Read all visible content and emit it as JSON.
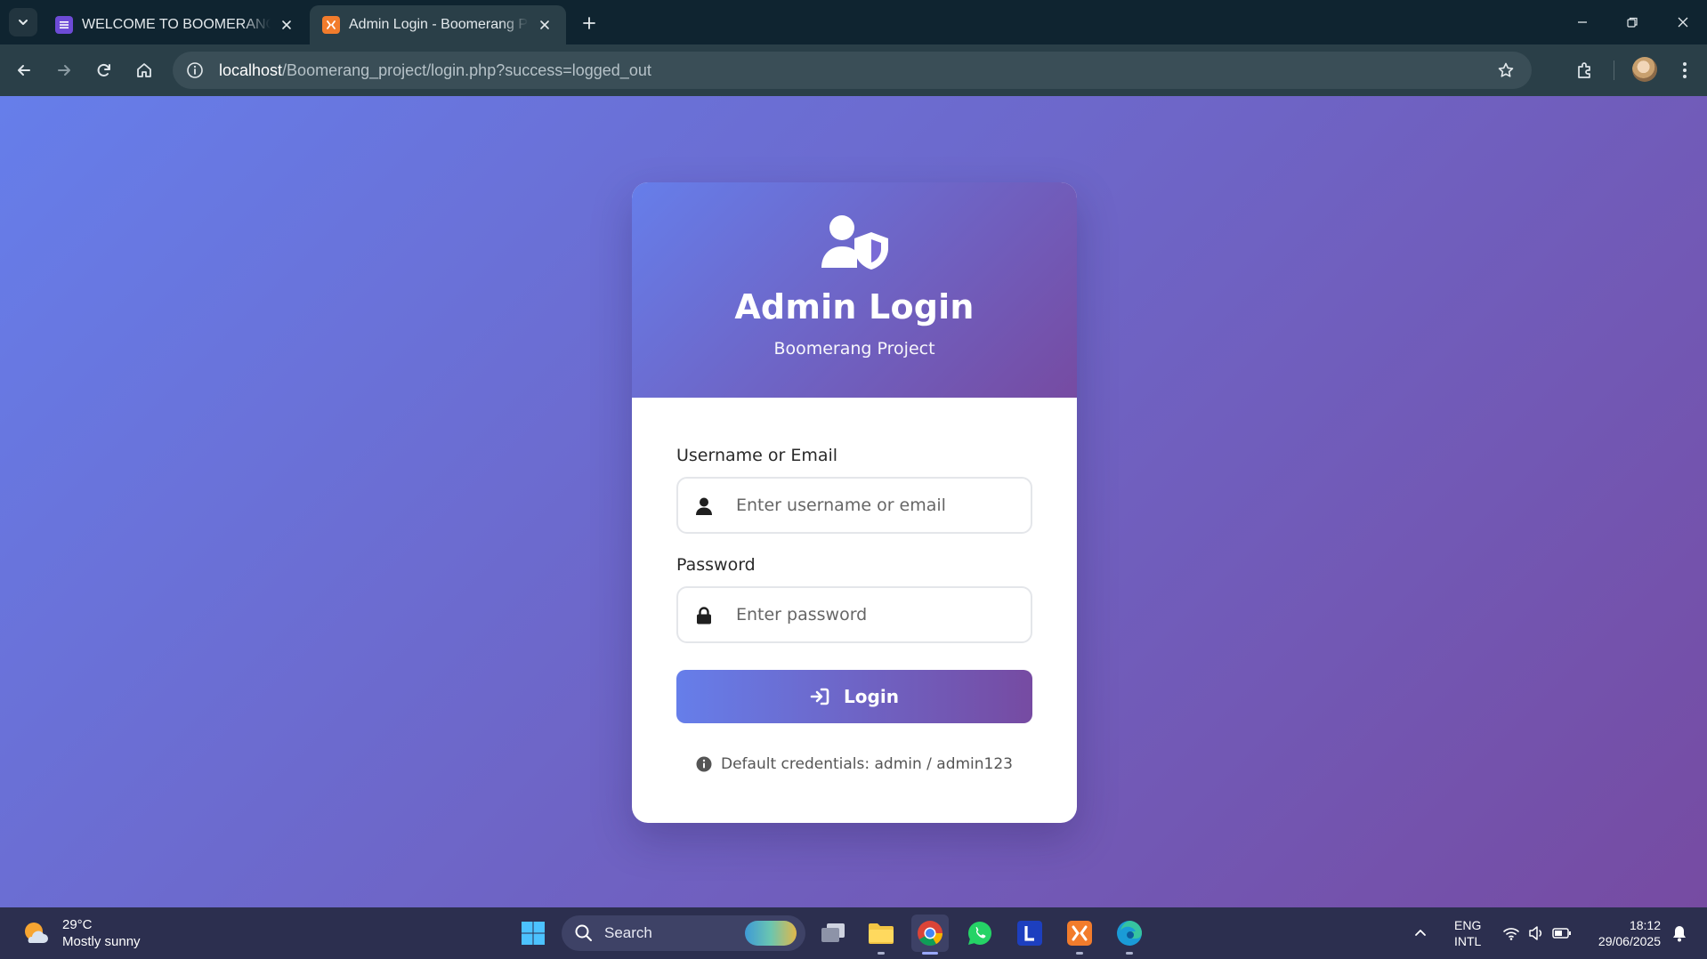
{
  "browser": {
    "tabs": [
      {
        "title": "WELCOME TO BOOMERANG SC",
        "icon": "list-icon",
        "active": false
      },
      {
        "title": "Admin Login - Boomerang Proj",
        "icon": "xampp-icon",
        "active": true
      }
    ],
    "address": {
      "host": "localhost",
      "path": "/Boomerang_project/login.php?success=logged_out"
    }
  },
  "page": {
    "title": "Admin Login",
    "subtitle": "Boomerang Project",
    "username": {
      "label": "Username or Email",
      "placeholder": "Enter username or email",
      "value": ""
    },
    "password": {
      "label": "Password",
      "placeholder": "Enter password",
      "value": ""
    },
    "login_label": "Login",
    "hint": "Default credentials: admin / admin123",
    "colors": {
      "gradient_start": "#667eea",
      "gradient_end": "#764ba2"
    }
  },
  "taskbar": {
    "weather": {
      "temp": "29°C",
      "condition": "Mostly sunny"
    },
    "search_label": "Search",
    "language": {
      "line1": "ENG",
      "line2": "INTL"
    },
    "clock": {
      "time": "18:12",
      "date": "29/06/2025"
    }
  }
}
